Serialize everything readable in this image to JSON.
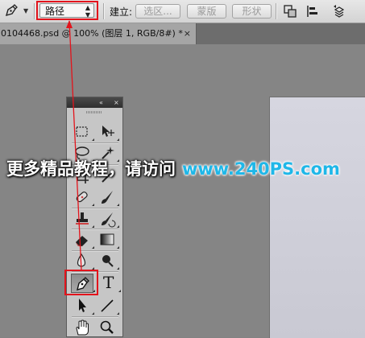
{
  "options_bar": {
    "tool_preset_icon": "pen-tool-icon",
    "mode_value": "路径",
    "make_label": "建立:",
    "selection_button": "选区...",
    "mask_button": "蒙版",
    "shape_button": "形状",
    "icons": [
      "path-operations-icon",
      "path-alignment-icon",
      "path-arrangement-icon"
    ]
  },
  "document_tab": {
    "title": "0104468.psd @ 100% (图层 1, RGB/8#) *",
    "close": "×"
  },
  "tools_panel": {
    "collapse_icon": "«",
    "close_icon": "×",
    "tools": [
      {
        "name": "rectangular-marquee-tool"
      },
      {
        "name": "move-tool"
      },
      {
        "name": "lasso-tool"
      },
      {
        "name": "magic-wand-tool"
      },
      {
        "name": "spot-healing-brush-tool"
      },
      {
        "name": "brush-tool"
      },
      {
        "name": "clone-stamp-tool"
      },
      {
        "name": "history-brush-tool"
      },
      {
        "name": "eraser-tool"
      },
      {
        "name": "gradient-tool"
      },
      {
        "name": "blur-tool"
      },
      {
        "name": "dodge-tool"
      },
      {
        "name": "pen-tool"
      },
      {
        "name": "type-tool",
        "glyph": "T"
      },
      {
        "name": "path-selection-tool"
      },
      {
        "name": "line-tool"
      },
      {
        "name": "hand-tool"
      },
      {
        "name": "zoom-tool"
      }
    ]
  },
  "watermark": {
    "chinese": "更多精品教程，请访问",
    "url": "www.240PS.com"
  },
  "colors": {
    "highlight": "#e3141c",
    "url_blue": "#1fb7e8"
  }
}
